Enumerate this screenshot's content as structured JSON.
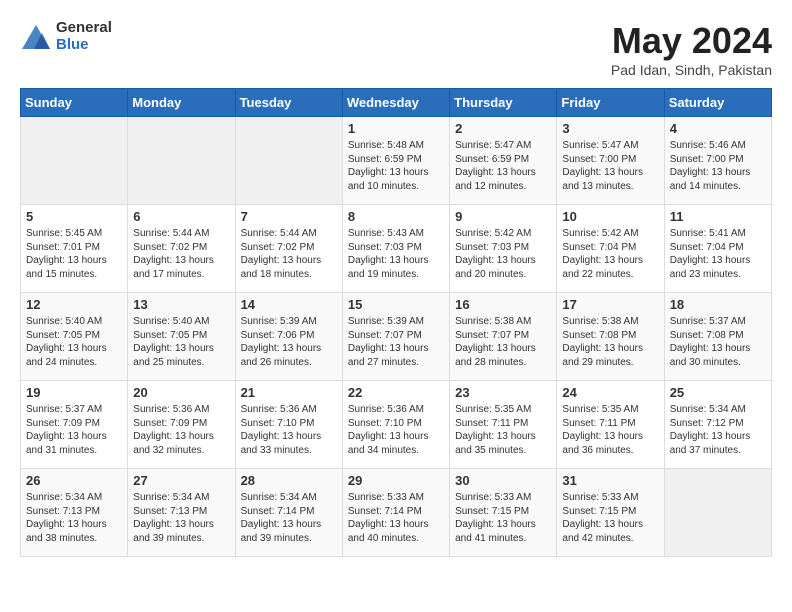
{
  "logo": {
    "general": "General",
    "blue": "Blue"
  },
  "title": {
    "month_year": "May 2024",
    "location": "Pad Idan, Sindh, Pakistan"
  },
  "days_of_week": [
    "Sunday",
    "Monday",
    "Tuesday",
    "Wednesday",
    "Thursday",
    "Friday",
    "Saturday"
  ],
  "weeks": [
    [
      {
        "day": "",
        "info": ""
      },
      {
        "day": "",
        "info": ""
      },
      {
        "day": "",
        "info": ""
      },
      {
        "day": "1",
        "info": "Sunrise: 5:48 AM\nSunset: 6:59 PM\nDaylight: 13 hours\nand 10 minutes."
      },
      {
        "day": "2",
        "info": "Sunrise: 5:47 AM\nSunset: 6:59 PM\nDaylight: 13 hours\nand 12 minutes."
      },
      {
        "day": "3",
        "info": "Sunrise: 5:47 AM\nSunset: 7:00 PM\nDaylight: 13 hours\nand 13 minutes."
      },
      {
        "day": "4",
        "info": "Sunrise: 5:46 AM\nSunset: 7:00 PM\nDaylight: 13 hours\nand 14 minutes."
      }
    ],
    [
      {
        "day": "5",
        "info": "Sunrise: 5:45 AM\nSunset: 7:01 PM\nDaylight: 13 hours\nand 15 minutes."
      },
      {
        "day": "6",
        "info": "Sunrise: 5:44 AM\nSunset: 7:02 PM\nDaylight: 13 hours\nand 17 minutes."
      },
      {
        "day": "7",
        "info": "Sunrise: 5:44 AM\nSunset: 7:02 PM\nDaylight: 13 hours\nand 18 minutes."
      },
      {
        "day": "8",
        "info": "Sunrise: 5:43 AM\nSunset: 7:03 PM\nDaylight: 13 hours\nand 19 minutes."
      },
      {
        "day": "9",
        "info": "Sunrise: 5:42 AM\nSunset: 7:03 PM\nDaylight: 13 hours\nand 20 minutes."
      },
      {
        "day": "10",
        "info": "Sunrise: 5:42 AM\nSunset: 7:04 PM\nDaylight: 13 hours\nand 22 minutes."
      },
      {
        "day": "11",
        "info": "Sunrise: 5:41 AM\nSunset: 7:04 PM\nDaylight: 13 hours\nand 23 minutes."
      }
    ],
    [
      {
        "day": "12",
        "info": "Sunrise: 5:40 AM\nSunset: 7:05 PM\nDaylight: 13 hours\nand 24 minutes."
      },
      {
        "day": "13",
        "info": "Sunrise: 5:40 AM\nSunset: 7:05 PM\nDaylight: 13 hours\nand 25 minutes."
      },
      {
        "day": "14",
        "info": "Sunrise: 5:39 AM\nSunset: 7:06 PM\nDaylight: 13 hours\nand 26 minutes."
      },
      {
        "day": "15",
        "info": "Sunrise: 5:39 AM\nSunset: 7:07 PM\nDaylight: 13 hours\nand 27 minutes."
      },
      {
        "day": "16",
        "info": "Sunrise: 5:38 AM\nSunset: 7:07 PM\nDaylight: 13 hours\nand 28 minutes."
      },
      {
        "day": "17",
        "info": "Sunrise: 5:38 AM\nSunset: 7:08 PM\nDaylight: 13 hours\nand 29 minutes."
      },
      {
        "day": "18",
        "info": "Sunrise: 5:37 AM\nSunset: 7:08 PM\nDaylight: 13 hours\nand 30 minutes."
      }
    ],
    [
      {
        "day": "19",
        "info": "Sunrise: 5:37 AM\nSunset: 7:09 PM\nDaylight: 13 hours\nand 31 minutes."
      },
      {
        "day": "20",
        "info": "Sunrise: 5:36 AM\nSunset: 7:09 PM\nDaylight: 13 hours\nand 32 minutes."
      },
      {
        "day": "21",
        "info": "Sunrise: 5:36 AM\nSunset: 7:10 PM\nDaylight: 13 hours\nand 33 minutes."
      },
      {
        "day": "22",
        "info": "Sunrise: 5:36 AM\nSunset: 7:10 PM\nDaylight: 13 hours\nand 34 minutes."
      },
      {
        "day": "23",
        "info": "Sunrise: 5:35 AM\nSunset: 7:11 PM\nDaylight: 13 hours\nand 35 minutes."
      },
      {
        "day": "24",
        "info": "Sunrise: 5:35 AM\nSunset: 7:11 PM\nDaylight: 13 hours\nand 36 minutes."
      },
      {
        "day": "25",
        "info": "Sunrise: 5:34 AM\nSunset: 7:12 PM\nDaylight: 13 hours\nand 37 minutes."
      }
    ],
    [
      {
        "day": "26",
        "info": "Sunrise: 5:34 AM\nSunset: 7:13 PM\nDaylight: 13 hours\nand 38 minutes."
      },
      {
        "day": "27",
        "info": "Sunrise: 5:34 AM\nSunset: 7:13 PM\nDaylight: 13 hours\nand 39 minutes."
      },
      {
        "day": "28",
        "info": "Sunrise: 5:34 AM\nSunset: 7:14 PM\nDaylight: 13 hours\nand 39 minutes."
      },
      {
        "day": "29",
        "info": "Sunrise: 5:33 AM\nSunset: 7:14 PM\nDaylight: 13 hours\nand 40 minutes."
      },
      {
        "day": "30",
        "info": "Sunrise: 5:33 AM\nSunset: 7:15 PM\nDaylight: 13 hours\nand 41 minutes."
      },
      {
        "day": "31",
        "info": "Sunrise: 5:33 AM\nSunset: 7:15 PM\nDaylight: 13 hours\nand 42 minutes."
      },
      {
        "day": "",
        "info": ""
      }
    ]
  ]
}
